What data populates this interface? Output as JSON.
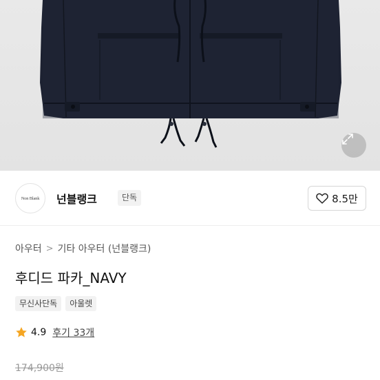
{
  "brand": {
    "logo_text": "Non Blank",
    "name": "넌블랭크",
    "badge": "단독",
    "like_count": "8.5만"
  },
  "breadcrumb": {
    "items": [
      "아우터",
      "기타 아우터 (넌블랭크)"
    ],
    "separator": ">"
  },
  "product": {
    "title": "후디드 파카_NAVY",
    "tags": [
      "무신사단독",
      "아울렛"
    ],
    "rating": "4.9",
    "reviews": "후기 33개",
    "original_price": "174,900원"
  },
  "icons": {
    "expand": "expand-icon",
    "heart": "heart-icon",
    "star": "star-icon"
  },
  "colors": {
    "garment": "#1d2233",
    "hero_bg": "#e6e6e6",
    "star": "#f5a623"
  }
}
